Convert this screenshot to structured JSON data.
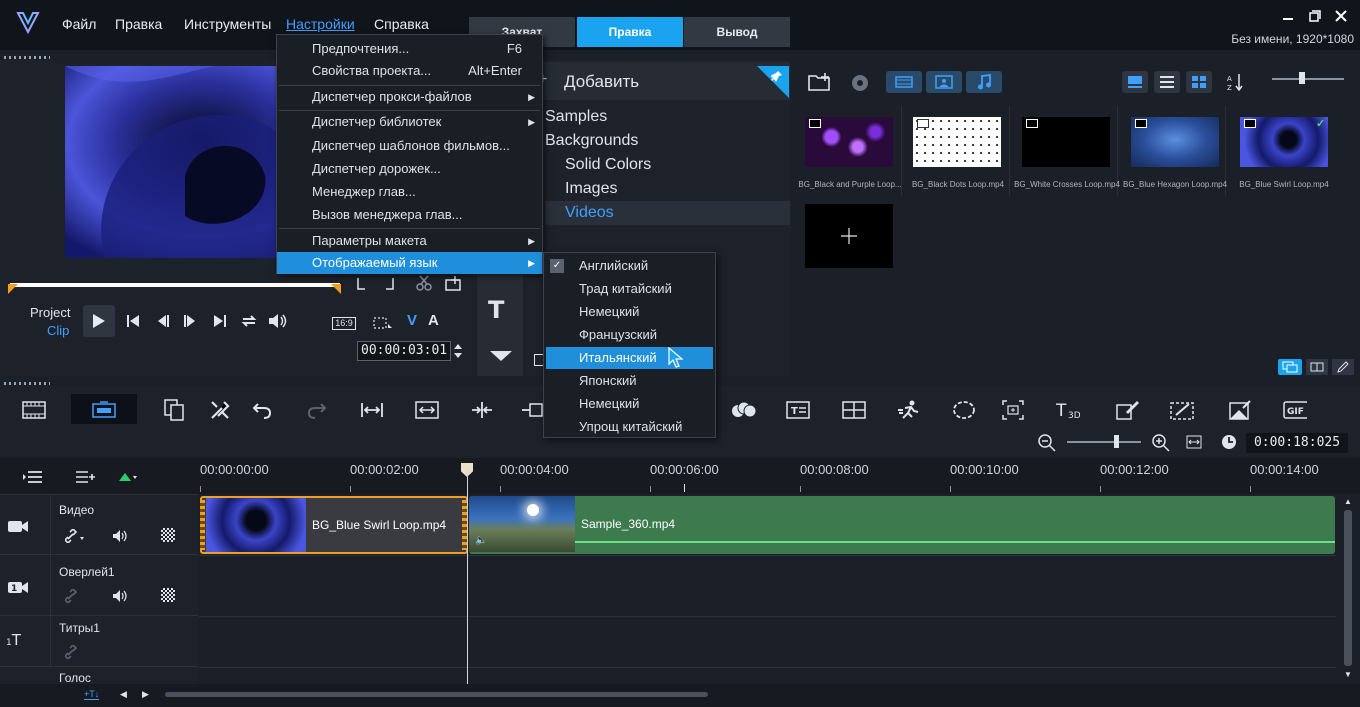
{
  "menubar": {
    "items": [
      "Файл",
      "Правка",
      "Инструменты",
      "Настройки",
      "Справка"
    ]
  },
  "tabs": [
    "Захват",
    "Правка",
    "Вывод"
  ],
  "project_info": "Без имени, 1920*1080",
  "settings_menu": {
    "items": [
      {
        "label": "Предпочтения...",
        "shortcut": "F6"
      },
      {
        "label": "Свойства проекта...",
        "shortcut": "Alt+Enter"
      },
      {
        "label": "Диспетчер прокси-файлов"
      },
      {
        "label": "Диспетчер библиотек"
      },
      {
        "label": "Диспетчер шаблонов фильмов..."
      },
      {
        "label": "Диспетчер дорожек..."
      },
      {
        "label": "Менеджер глав..."
      },
      {
        "label": "Вызов менеджера глав..."
      },
      {
        "label": "Параметры макета"
      },
      {
        "label": "Отображаемый язык"
      }
    ]
  },
  "language_menu": {
    "items": [
      "Английский",
      "Трад китайский",
      "Немецкий",
      "Французский",
      "Итальянский",
      "Японский",
      "Немецкий",
      "Упрощ китайский"
    ],
    "checked": "Английский",
    "highlighted": "Итальянский"
  },
  "preview": {
    "project_label": "Project",
    "clip_label": "Clip",
    "aspect": "16:9",
    "timecode": "00:00:03:01"
  },
  "library": {
    "add_label": "Добавить",
    "tree": [
      "Samples",
      "Backgrounds",
      "Solid Colors",
      "Images",
      "Videos"
    ],
    "selected": "Videos",
    "thumbnails": [
      {
        "name": "BG_Black and Purple Loop...",
        "thumb": "purple"
      },
      {
        "name": "BG_Black Dots Loop.mp4",
        "thumb": "dots"
      },
      {
        "name": "BG_White Crosses Loop.mp4",
        "thumb": "black"
      },
      {
        "name": "BG_Blue Hexagon Loop.mp4",
        "thumb": "blue"
      },
      {
        "name": "BG_Blue Swirl Loop.mp4",
        "thumb": "swirl"
      }
    ]
  },
  "timeline": {
    "duration": "0:00:18:025",
    "ruler": [
      "00:00:00:00",
      "00:00:02:00",
      "00:00:04:00",
      "00:00:06:00",
      "00:00:08:00",
      "00:00:10:00",
      "00:00:12:00",
      "00:00:14:00"
    ],
    "tracks": [
      "Видео",
      "Оверлей1",
      "Титры1",
      "Голос"
    ],
    "clips": [
      "BG_Blue Swirl Loop.mp4",
      "Sample_360.mp4"
    ]
  },
  "colors": {
    "accent": "#1aa3ef",
    "clip_green": "#3d7a4d",
    "clip_orange": "#f0a020"
  }
}
